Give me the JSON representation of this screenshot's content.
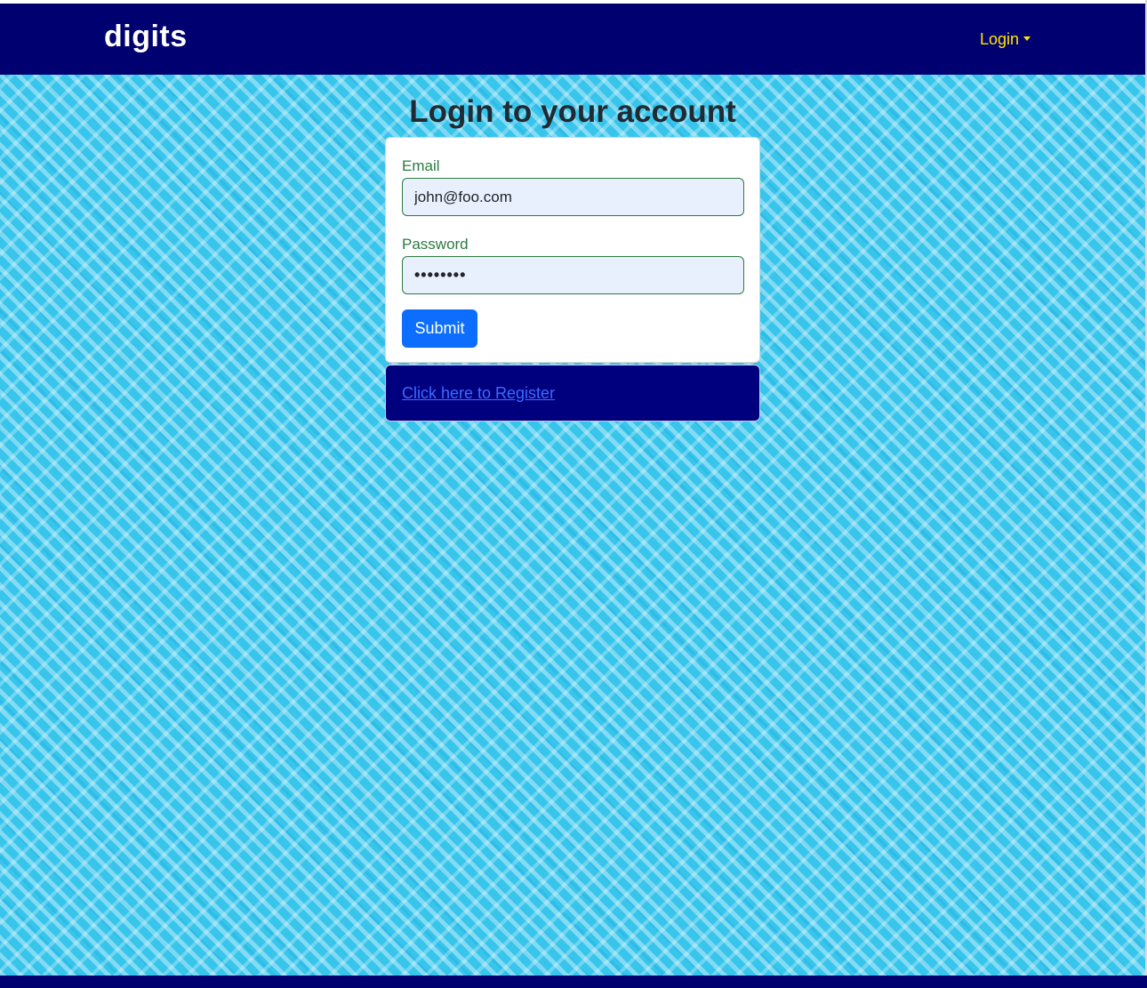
{
  "navbar": {
    "brand": "digits",
    "login_menu": "Login"
  },
  "main": {
    "title": "Login to your account"
  },
  "form": {
    "email_label": "Email",
    "email_value": "john@foo.com",
    "password_label": "Password",
    "password_value": "••••••••",
    "submit_label": "Submit"
  },
  "register": {
    "link_text": "Click here to Register"
  },
  "colors": {
    "navbar": "#000070",
    "brand_text": "#ffffff",
    "login_text": "#ffe600",
    "background": "#38c5ec",
    "label_green": "#2c7a40",
    "input_fill": "#e8f0fe",
    "submit_button": "#0d6efd",
    "register_panel": "#00007f",
    "register_link": "#3a6bff"
  },
  "icons": {
    "login_dropdown": "caret-down-icon"
  }
}
